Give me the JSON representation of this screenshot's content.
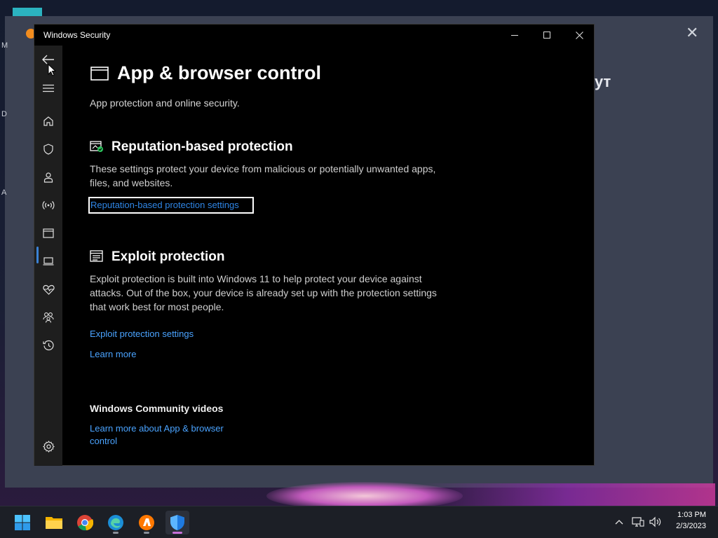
{
  "window": {
    "title": "Windows Security",
    "controls": {
      "minimize": "minimize-icon",
      "maximize": "maximize-icon",
      "close": "close-icon"
    }
  },
  "background_window": {
    "title_fragment": "ут",
    "edge_letters": [
      "M",
      "D",
      "A"
    ]
  },
  "nav": {
    "items": [
      "back-arrow-icon",
      "hamburger-icon",
      "home-icon",
      "shield-icon",
      "person-icon",
      "wireless-icon",
      "app-browser-icon",
      "laptop-icon",
      "heart-pulse-icon",
      "family-icon",
      "history-icon",
      "settings-gear-icon"
    ],
    "active": "app-browser-icon",
    "accent": "#3b82d6"
  },
  "page": {
    "title": "App & browser control",
    "subtitle": "App protection and online security."
  },
  "reputation": {
    "title": "Reputation-based protection",
    "description": "These settings protect your device from malicious or potentially unwanted apps, files, and websites.",
    "link": "Reputation-based protection settings",
    "status_color": "#2dc55e"
  },
  "exploit": {
    "title": "Exploit protection",
    "description": "Exploit protection is built into Windows 11 to help protect your device against attacks.  Out of the box, your device is already set up with the protection settings that work best for most people.",
    "link_settings": "Exploit protection settings",
    "link_learn": "Learn more"
  },
  "community": {
    "title": "Windows Community videos",
    "link": "Learn more about App & browser control"
  },
  "taskbar": {
    "apps": [
      "windows-start-icon",
      "file-explorer-icon",
      "chrome-icon",
      "edge-icon",
      "avast-icon",
      "windows-security-icon"
    ],
    "active_app": "windows-security-icon",
    "tray": [
      "chevron-up-icon",
      "network-icon",
      "volume-icon"
    ],
    "time": "1:03 PM",
    "date": "2/3/2023"
  },
  "colors": {
    "link": "#4aa3ff",
    "window_bg": "#000000",
    "rail_bg": "#1e1e1e"
  }
}
